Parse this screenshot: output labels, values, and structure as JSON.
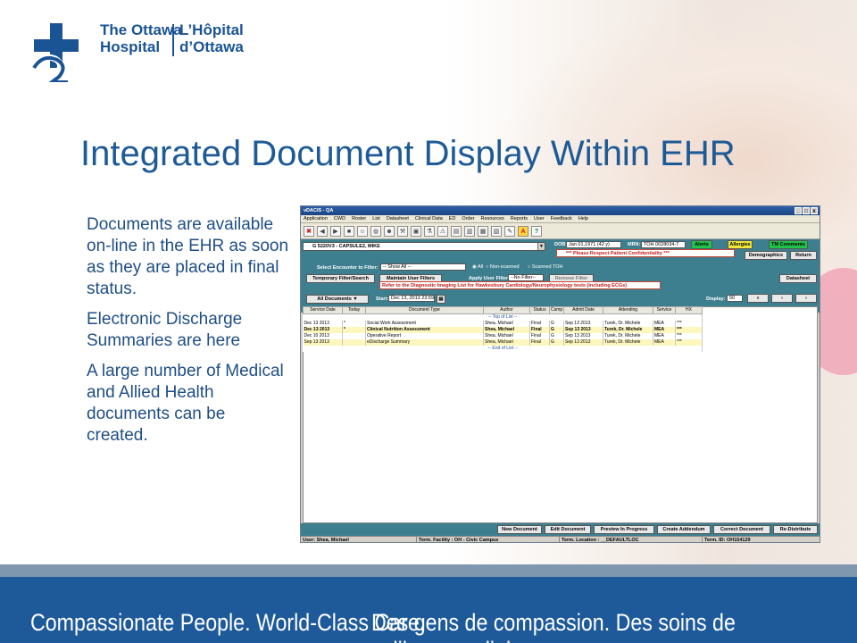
{
  "logo": {
    "en_line1": "The Ottawa",
    "en_line2": "Hospital",
    "fr_line1": "L’Hôpital",
    "fr_line2": "d’Ottawa"
  },
  "slide_title": "Integrated Document Display Within EHR",
  "bullets": [
    "Documents are available on-line in the EHR as soon as they are placed in final status.",
    "Electronic Discharge Summaries are here",
    "A large number of Medical and Allied Health documents can be created."
  ],
  "footer": {
    "en": "Compassionate People. World-Class Care.",
    "fr": "Des gens de compassion. Des soins de calibre mondial."
  },
  "app": {
    "window_title": "vDACIS - QA",
    "window_buttons": [
      "_",
      "□",
      "x"
    ],
    "menu": [
      "Application",
      "CWD",
      "Roster",
      "List",
      "Datasheet",
      "Clinical Data",
      "ED",
      "Order",
      "Resources",
      "Reports",
      "User",
      "Feedback",
      "Help"
    ],
    "patient": "G 5220V3 - CAPSULE2, MIKE",
    "dob_label": "DOB:",
    "dob_value": "Jan 01,1971 (42 y)",
    "mrn_label": "MRN:",
    "mrn_value": "TOH 0028034-7",
    "alerts": "Alerts",
    "allergies": "Allergies",
    "tm_comments": "TM Comments",
    "confidentiality": "*** Please Respect Patient Confidentiality ***",
    "demographics": "Demographics",
    "return": "Return",
    "encounter_label": "Select Encounter to Filter:",
    "encounter_value": "-- Show All --",
    "radio_all": "All",
    "radio_nonscanned": "Non-scanned",
    "radio_scanned": "Scanned TOH",
    "temp_filter": "Temporary Filter/Search",
    "maintain_filters": "Maintain User Filters",
    "apply_filter_label": "Apply User Filter:",
    "apply_filter_value": "--No Filter--",
    "remove_filter": "Remove Filter",
    "datasheet": "Datasheet",
    "imaging_note": "Refer to the Diagnostic Imaging List for Hawkesbury Cardiology/Neurophysiology tests (including ECGs)",
    "all_documents": "All Documents",
    "start_label": "Start:",
    "start_value": "Dec 13, 2013 23:59",
    "display_label": "Display:",
    "display_value": "50",
    "columns": [
      "Service Date",
      "Today",
      "Document Type",
      "Author",
      "Status",
      "Camp",
      "Admit Date",
      "Attending",
      "Service",
      "HX"
    ],
    "top_marker": "-- Top of List --",
    "end_marker": "-- End of List --",
    "rows": [
      [
        "Dec 13 2013",
        "*",
        "Social Work Assessment",
        "Shea, Michael",
        "Final",
        "G",
        "Sep 13 2013",
        "Turek, Dr. Michele",
        "MEA",
        "***"
      ],
      [
        "Dec 13 2013",
        "*",
        "Clinical Nutrition Assessment",
        "Shea, Michael",
        "Final",
        "G",
        "Sep 13 2013",
        "Turek, Dr. Michele",
        "MEA",
        "***"
      ],
      [
        "Dec 10 2013",
        "",
        "Operative Report",
        "Shea, Michael",
        "Final",
        "G",
        "Sep 13 2013",
        "Turek, Dr. Michele",
        "MEA",
        "***"
      ],
      [
        "Sep 13 2013",
        "",
        "eDischarge Summary",
        "Shea, Michael",
        "Final",
        "G",
        "Sep 13 2013",
        "Turek, Dr. Michele",
        "MEA",
        "***"
      ]
    ],
    "bottom_buttons": [
      "New Document",
      "Edit Document",
      "Preview In Progress",
      "Create Addendum",
      "Correct Document",
      "Re-Distribute"
    ],
    "status": {
      "user": "User: Shea, Michael",
      "facility": "Term. Facility : OH - Civic Campus",
      "location": "Term. Location : __DEFAULTLOC",
      "term_id": "Term. ID: OH154129"
    }
  }
}
